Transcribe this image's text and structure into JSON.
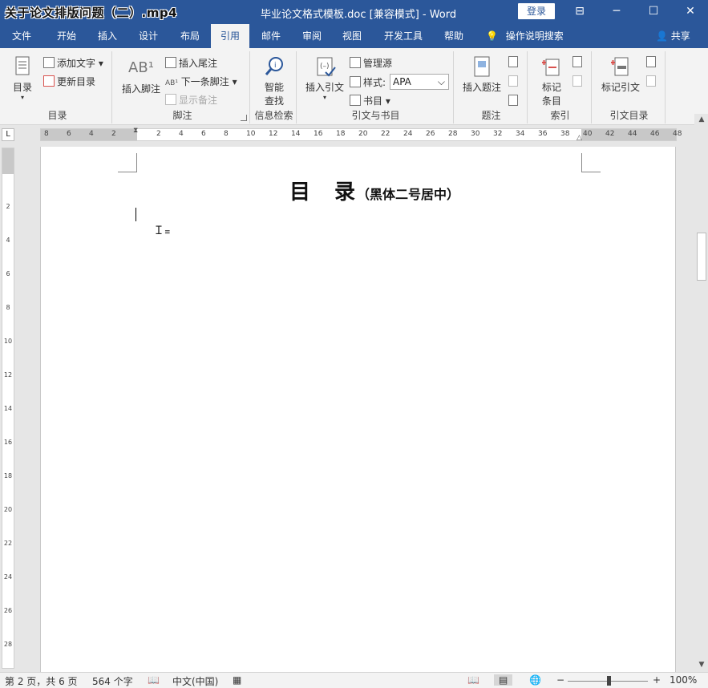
{
  "title_bar": {
    "overlay_title": "关于论文排版问题（二）.mp4",
    "doc_title": "毕业论文格式模板.doc [兼容模式]  -  Word",
    "login_button": "登录",
    "controls": [
      "⊟",
      "─",
      "☐",
      "✕"
    ]
  },
  "tabs": [
    "文件",
    "开始",
    "插入",
    "设计",
    "布局",
    "引用",
    "邮件",
    "审阅",
    "视图",
    "开发工具",
    "帮助"
  ],
  "active_tab": "引用",
  "tell_me": "操作说明搜索",
  "share": "共享",
  "ribbon": {
    "toc_group": {
      "label": "目录",
      "toc_button": "目录",
      "add_text": "添加文字",
      "update_table": "更新目录"
    },
    "footnote_group": {
      "label": "脚注",
      "insert_footnote": "插入脚注",
      "insert_endnote": "插入尾注",
      "next_footnote": "下一条脚注",
      "show_notes": "显示备注"
    },
    "research_group": {
      "label": "信息检索",
      "smart_lookup": "智能查找"
    },
    "citations_group": {
      "label": "引文与书目",
      "insert_citation": "插入引文",
      "manage_sources": "管理源",
      "style_label": "样式:",
      "style_value": "APA",
      "bibliography": "书目"
    },
    "captions_group": {
      "label": "题注",
      "insert_caption": "插入题注"
    },
    "index_group": {
      "label": "索引",
      "mark_entry": "标记条目"
    },
    "toa_group": {
      "label": "引文目录",
      "mark_citation": "标记引文"
    }
  },
  "ruler": {
    "h_numbers": [
      "8",
      "6",
      "4",
      "2",
      "",
      "2",
      "4",
      "6",
      "8",
      "10",
      "12",
      "14",
      "16",
      "18",
      "20",
      "22",
      "24",
      "26",
      "28",
      "30",
      "32",
      "34",
      "36",
      "38",
      "40",
      "42",
      "44",
      "46",
      "48"
    ],
    "v_numbers": [
      "2",
      "4",
      "6",
      "8",
      "10",
      "12",
      "14",
      "16",
      "18",
      "20",
      "22",
      "24",
      "26",
      "28",
      "30"
    ],
    "corner": "L"
  },
  "document": {
    "toc_heading": "目　录",
    "toc_note": "（黑体二号居中）"
  },
  "status": {
    "page": "第 2 页，共 6 页",
    "words": "564 个字",
    "language": "中文(中国)",
    "zoom": "100%"
  },
  "colors": {
    "ribbon_blue": "#2b579a",
    "ribbon_body": "#f3f3f3"
  }
}
